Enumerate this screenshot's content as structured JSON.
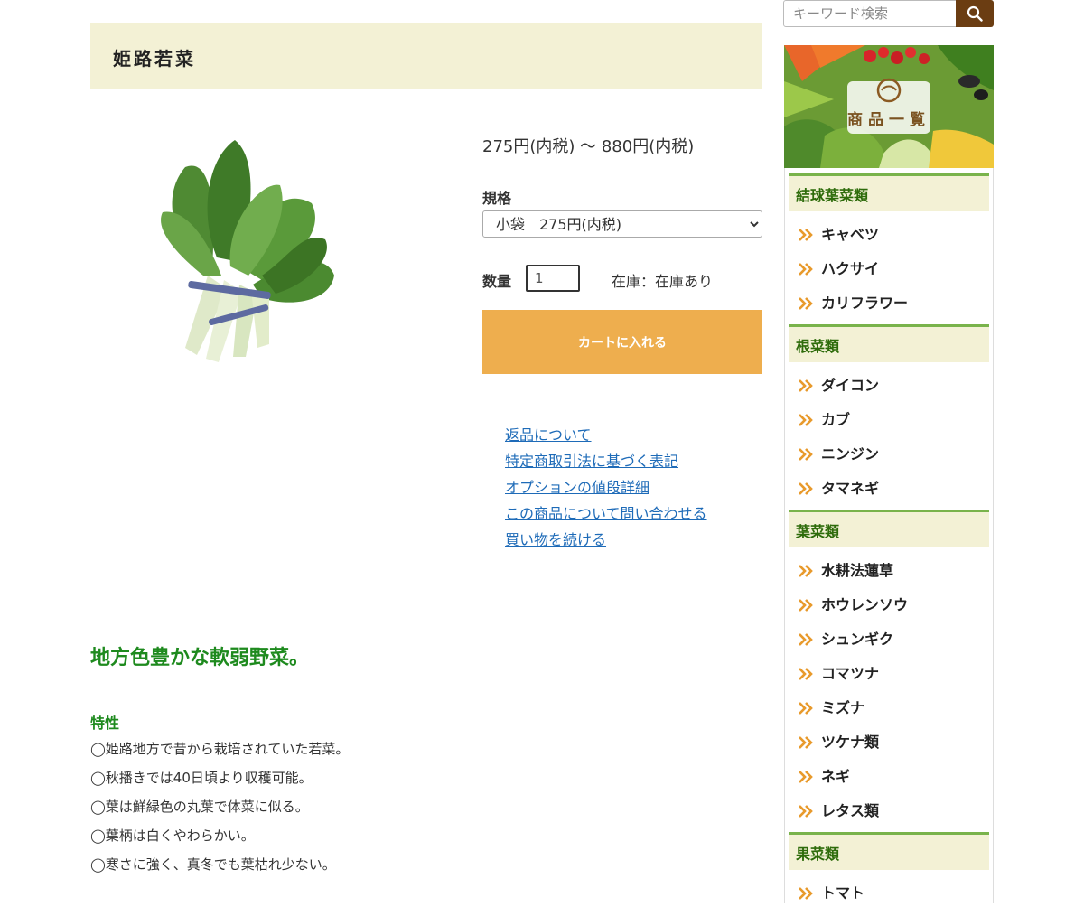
{
  "product": {
    "title": "姫路若菜",
    "price": "275円(内税) 〜 880円(内税)",
    "spec_label": "規格",
    "spec_selected": "小袋　275円(内税)",
    "qty_label": "数量",
    "qty_value": "1",
    "stock": "在庫：在庫あり",
    "cart_button": "カートに入れる"
  },
  "links": [
    "返品について",
    "特定商取引法に基づく表記",
    "オプションの値段詳細",
    "この商品について問い合わせる",
    "買い物を続ける"
  ],
  "description": {
    "headline": "地方色豊かな軟弱野菜。",
    "features_title": "特性",
    "features": [
      "◯姫路地方で昔から栽培されていた若菜。",
      "◯秋播きでは40日頃より収穫可能。",
      "◯葉は鮮緑色の丸葉で体菜に似る。",
      "◯葉柄は白くやわらかい。",
      "◯寒さに強く、真冬でも葉枯れ少ない。"
    ]
  },
  "search": {
    "placeholder": "キーワード検索"
  },
  "banner": {
    "label": "商品一覧"
  },
  "categories": [
    {
      "name": "結球葉菜類",
      "items": [
        "キャベツ",
        "ハクサイ",
        "カリフラワー"
      ]
    },
    {
      "name": "根菜類",
      "items": [
        "ダイコン",
        "カブ",
        "ニンジン",
        "タマネギ"
      ]
    },
    {
      "name": "葉菜類",
      "items": [
        "水耕法蓮草",
        "ホウレンソウ",
        "シュンギク",
        "コマツナ",
        "ミズナ",
        "ツケナ類",
        "ネギ",
        "レタス類"
      ]
    },
    {
      "name": "果菜類",
      "items": [
        "トマト"
      ]
    }
  ],
  "colors": {
    "title_bg": "#f3f1d5",
    "cart_button": "#eeae4e",
    "link": "#1e6bb8",
    "headline_green": "#1e8a1e",
    "category_border": "#79b34b",
    "chevron": "#e89a2c",
    "search_button": "#6b3d12"
  },
  "icons": {
    "search": "search-icon",
    "chevron": "double-chevron-right-icon",
    "banner": "vegetable-basket-icon"
  }
}
